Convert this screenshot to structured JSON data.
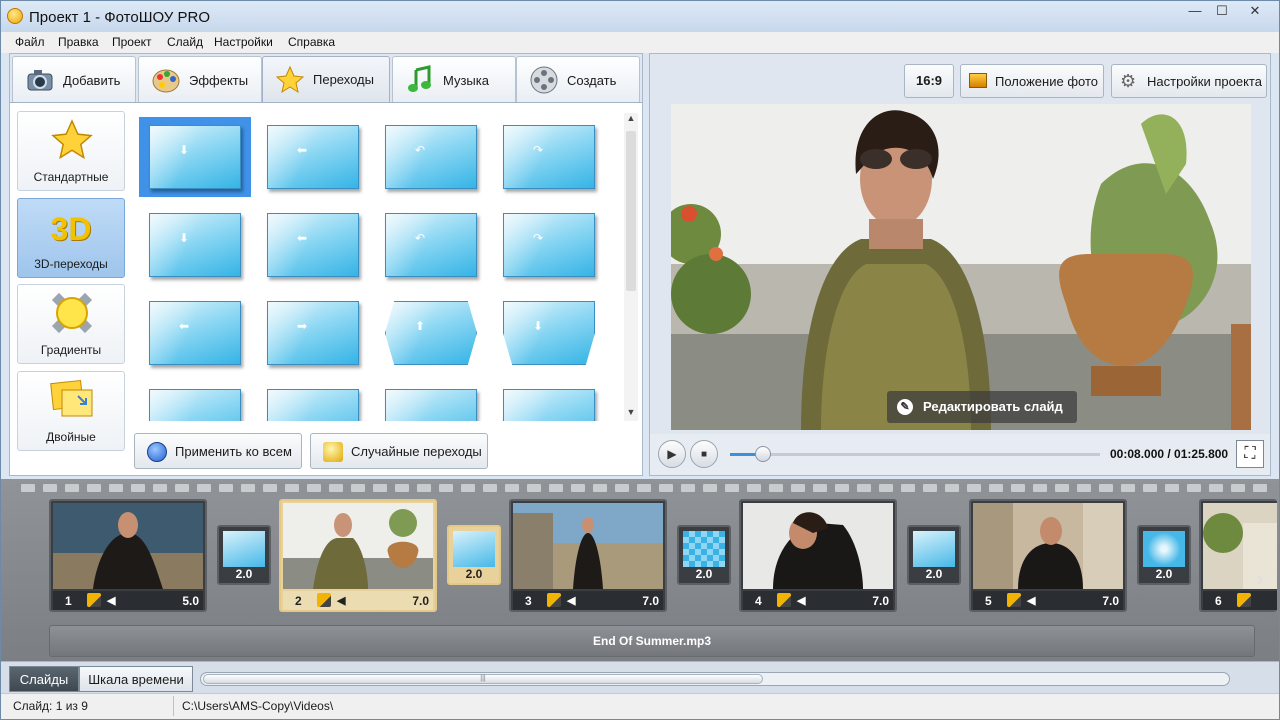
{
  "window": {
    "title": "Проект 1 - ФотоШОУ PRO",
    "minimize": "—",
    "maximize": "☐",
    "close": "✕"
  },
  "menu": [
    "Файл",
    "Правка",
    "Проект",
    "Слайд",
    "Настройки",
    "Справка"
  ],
  "tabs": [
    {
      "label": "Добавить",
      "icon": "camera-icon"
    },
    {
      "label": "Эффекты",
      "icon": "palette-icon"
    },
    {
      "label": "Переходы",
      "icon": "star-icon",
      "active": true
    },
    {
      "label": "Музыка",
      "icon": "music-note-icon"
    },
    {
      "label": "Создать",
      "icon": "film-reel-icon"
    }
  ],
  "categories": [
    {
      "label": "Стандартные",
      "icon": "star-icon"
    },
    {
      "label": "3D-переходы",
      "icon": "3d-icon",
      "badge": "3D",
      "selected": true
    },
    {
      "label": "Градиенты",
      "icon": "gradient-sun-icon"
    },
    {
      "label": "Двойные",
      "icon": "double-note-icon"
    }
  ],
  "transition_arrows": [
    "⬇",
    "⬅",
    "↶",
    "↷",
    "⬇",
    "⬅",
    "↶",
    "↷",
    "⬅",
    "➡",
    "⬆",
    "⬇",
    "",
    "",
    "",
    ""
  ],
  "panel_buttons": {
    "apply_all": "Применить ко всем",
    "random": "Случайные переходы"
  },
  "right_toolbar": {
    "aspect": "16:9",
    "photo_position": "Положение фото",
    "project_settings": "Настройки проекта"
  },
  "preview": {
    "edit_slide": "Редактировать слайд"
  },
  "player": {
    "time": "00:08.000 / 01:25.800",
    "progress": 0.09,
    "play": "▶",
    "stop": "■",
    "fullscreen": "⛶"
  },
  "slides": [
    {
      "num": "1",
      "duration": "5.0"
    },
    {
      "num": "2",
      "duration": "7.0",
      "selected": true
    },
    {
      "num": "3",
      "duration": "7.0"
    },
    {
      "num": "4",
      "duration": "7.0"
    },
    {
      "num": "5",
      "duration": "7.0"
    },
    {
      "num": "6",
      "duration": ""
    }
  ],
  "transitions": [
    {
      "duration": "2.0"
    },
    {
      "duration": "2.0",
      "selected": true
    },
    {
      "duration": "2.0"
    },
    {
      "duration": "2.0"
    },
    {
      "duration": "2.0"
    }
  ],
  "music_track": "End Of Summer.mp3",
  "bottom_tabs": {
    "slides": "Слайды",
    "timeline": "Шкала времени"
  },
  "scroll_grip": "|||",
  "status": {
    "slide": "Слайд: 1 из 9",
    "path": "C:\\Users\\AMS-Copy\\Videos\\"
  }
}
